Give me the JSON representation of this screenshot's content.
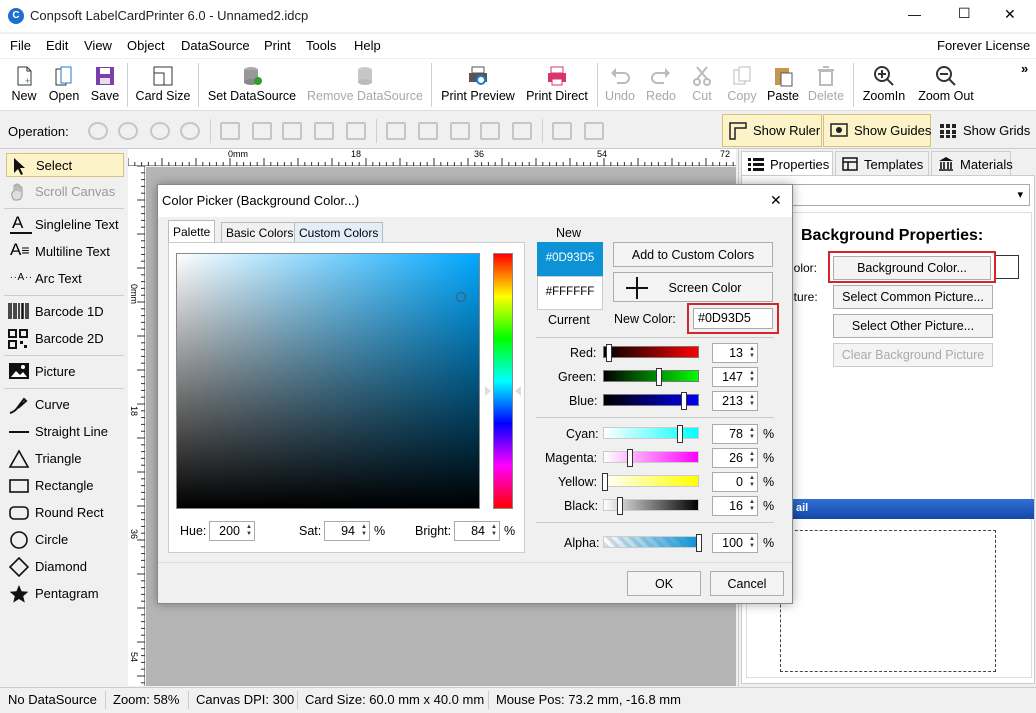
{
  "window": {
    "title": "Conpsoft LabelCardPrinter 6.0 - Unnamed2.idcp",
    "controls": {
      "minimize": "—",
      "maximize": "☐",
      "close": "✕"
    }
  },
  "menu": {
    "items": [
      "File",
      "Edit",
      "View",
      "Object",
      "DataSource",
      "Print",
      "Tools",
      "Help"
    ],
    "license": "Forever License"
  },
  "toolbar": {
    "new": "New",
    "open": "Open",
    "save": "Save",
    "card_size": "Card Size",
    "set_datasource": "Set DataSource",
    "remove_datasource": "Remove DataSource",
    "print_preview": "Print Preview",
    "print_direct": "Print Direct",
    "undo": "Undo",
    "redo": "Redo",
    "cut": "Cut",
    "copy": "Copy",
    "paste": "Paste",
    "delete": "Delete",
    "zoomin": "ZoomIn",
    "zoomout": "Zoom Out",
    "more": "»"
  },
  "operation": {
    "label": "Operation:",
    "show_ruler": "Show Ruler",
    "show_guides": "Show Guides",
    "show_grids": "Show Grids"
  },
  "tools": {
    "select": "Select",
    "scroll_canvas": "Scroll Canvas",
    "singleline_text": "Singleline Text",
    "multiline_text": "Multiline Text",
    "arc_text": "Arc Text",
    "barcode_1d": "Barcode 1D",
    "barcode_2d": "Barcode 2D",
    "picture": "Picture",
    "curve": "Curve",
    "straight_line": "Straight Line",
    "triangle": "Triangle",
    "rectangle": "Rectangle",
    "round_rect": "Round Rect",
    "circle": "Circle",
    "diamond": "Diamond",
    "pentagram": "Pentagram"
  },
  "ruler": {
    "h_ticks": [
      "0mm",
      "18",
      "36",
      "54",
      "72"
    ],
    "v_ticks": [
      "0mm",
      "18",
      "36",
      "54"
    ]
  },
  "right_panel": {
    "tabs": {
      "properties": "Properties",
      "templates": "Templates",
      "materials": "Materials"
    },
    "section_title": "Background Properties:",
    "color_label": "Color:",
    "picture_label": "Picture:",
    "bg_color_button": "Background Color...",
    "select_common_picture": "Select Common Picture...",
    "select_other_picture": "Select Other Picture...",
    "clear_bg_picture": "Clear Background Picture",
    "detail_bar": "ail",
    "dropdown_arrow": "▾"
  },
  "status": {
    "datasource": "No DataSource",
    "zoom": "Zoom: 58%",
    "dpi": "Canvas DPI: 300",
    "card_size": "Card Size: 60.0 mm x 40.0 mm",
    "mouse_pos": "Mouse Pos: 73.2 mm, -16.8 mm"
  },
  "dialog": {
    "title": "Color Picker (Background Color...)",
    "close": "✕",
    "tabs": {
      "palette": "Palette",
      "basic": "Basic Colors",
      "custom": "Custom Colors"
    },
    "new_label": "New",
    "current_label": "Current",
    "new_color": "#0D93D5",
    "current_color": "#FFFFFF",
    "add_custom": "Add to Custom Colors",
    "screen_color": "Screen Color",
    "new_color_label": "New Color:",
    "new_color_value": "#0D93D5",
    "hue_label": "Hue:",
    "hue": "200",
    "sat_label": "Sat:",
    "sat": "94",
    "bright_label": "Bright:",
    "bright": "84",
    "percent": "%",
    "red_label": "Red:",
    "red": "13",
    "green_label": "Green:",
    "green": "147",
    "blue_label": "Blue:",
    "blue": "213",
    "cyan_label": "Cyan:",
    "cyan": "78",
    "magenta_label": "Magenta:",
    "magenta": "26",
    "yellow_label": "Yellow:",
    "yellow": "0",
    "black_label": "Black:",
    "black": "16",
    "alpha_label": "Alpha:",
    "alpha": "100",
    "ok": "OK",
    "cancel": "Cancel"
  },
  "colors": {
    "accent": "#0D93D5",
    "selected_bg": "#fcf3c9",
    "highlight_red": "#d3262b"
  }
}
